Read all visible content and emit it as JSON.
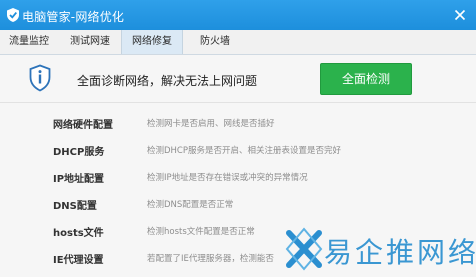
{
  "window": {
    "title": "电脑管家-网络优化",
    "logo_icon": "shield-logo-icon",
    "close_icon": "close-icon"
  },
  "tabs": [
    {
      "label": "流量监控",
      "active": false
    },
    {
      "label": "测试网速",
      "active": false
    },
    {
      "label": "网络修复",
      "active": true
    },
    {
      "label": "防火墙",
      "active": false
    }
  ],
  "banner": {
    "headline": "全面诊断网络，解决无法上网问题",
    "button_label": "全面检测",
    "icon": "info-shield-icon"
  },
  "items": [
    {
      "name": "网络硬件配置",
      "desc": "检测网卡是否启用、网线是否插好"
    },
    {
      "name": "DHCP服务",
      "desc": "检测DHCP服务是否开启、相关注册表设置是否完好"
    },
    {
      "name": "IP地址配置",
      "desc": "检测IP地址是否存在错误或冲突的异常情况"
    },
    {
      "name": "DNS配置",
      "desc": "检测DNS配置是否正常"
    },
    {
      "name": "hosts文件",
      "desc": "检测hosts文件配置是否正常"
    },
    {
      "name": "IE代理设置",
      "desc": "若配置了IE代理服务器，检测能否"
    }
  ],
  "watermark": {
    "text": "易企推网络",
    "icon": "watermark-logo-icon"
  },
  "colors": {
    "titlebar": "#1d8fdc",
    "button": "#2bb24c",
    "accent": "#2b8fd0"
  }
}
